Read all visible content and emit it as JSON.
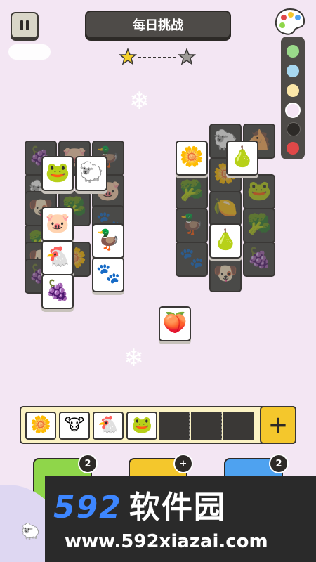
{
  "header": {
    "title": "每日挑战"
  },
  "pause_icon": "pause-icon",
  "progress": {
    "start_icon": "star-filled-icon",
    "end_icon": "star-empty-icon"
  },
  "palette": {
    "icon": "palette-icon",
    "colors": [
      "#9ad98a",
      "#a8d8f0",
      "#fbe6a8",
      "#f5e6f5",
      "#2d2a27",
      "#e04848"
    ]
  },
  "board": {
    "left_tiles": [
      {
        "glyph": "🍇",
        "state": "dark"
      },
      {
        "glyph": "🐷",
        "state": "dark"
      },
      {
        "glyph": "🦆",
        "state": "dark"
      },
      {
        "glyph": "🐸",
        "state": "light"
      },
      {
        "glyph": "🐑",
        "state": "light"
      },
      {
        "glyph": "🐑",
        "state": "dark"
      },
      {
        "glyph": "🐷",
        "state": "dark"
      },
      {
        "glyph": "🥦",
        "state": "dark"
      },
      {
        "glyph": "🐶",
        "state": "dark"
      },
      {
        "glyph": "🐷",
        "state": "light"
      },
      {
        "glyph": "🐶",
        "state": "dark"
      },
      {
        "glyph": "🦆",
        "state": "light"
      },
      {
        "glyph": "🐔",
        "state": "light"
      },
      {
        "glyph": "🌼",
        "state": "dark"
      },
      {
        "glyph": "🐾",
        "state": "light"
      },
      {
        "glyph": "🍇",
        "state": "light"
      }
    ],
    "right_tiles": [
      {
        "glyph": "🐑",
        "state": "dark"
      },
      {
        "glyph": "🐴",
        "state": "dark"
      },
      {
        "glyph": "🌼",
        "state": "light"
      },
      {
        "glyph": "🍐",
        "state": "light"
      },
      {
        "glyph": "🥦",
        "state": "dark"
      },
      {
        "glyph": "🐸",
        "state": "dark"
      },
      {
        "glyph": "🍋",
        "state": "dark"
      },
      {
        "glyph": "🌼",
        "state": "dark"
      },
      {
        "glyph": "🦆",
        "state": "dark"
      },
      {
        "glyph": "🍐",
        "state": "light"
      },
      {
        "glyph": "🥦",
        "state": "dark"
      },
      {
        "glyph": "🐾",
        "state": "dark"
      },
      {
        "glyph": "🐶",
        "state": "dark"
      },
      {
        "glyph": "🍇",
        "state": "dark"
      }
    ],
    "single_tile": {
      "glyph": "🍑",
      "state": "light"
    }
  },
  "tray": {
    "slots": [
      {
        "glyph": "🌼",
        "name": "flower"
      },
      {
        "glyph": "🐮",
        "name": "cow"
      },
      {
        "glyph": "🐔",
        "name": "chicken"
      },
      {
        "glyph": "🐸",
        "name": "frog"
      },
      {
        "glyph": "",
        "name": "empty"
      },
      {
        "glyph": "",
        "name": "empty"
      },
      {
        "glyph": "",
        "name": "empty"
      }
    ],
    "add_label": "+"
  },
  "tools": [
    {
      "name": "undo-tool",
      "color": "#8fd64a",
      "badge": "2"
    },
    {
      "name": "hint-tool",
      "color": "#f4c72c",
      "badge": "+"
    },
    {
      "name": "shuffle-tool",
      "color": "#4ea2f0",
      "badge": "2"
    }
  ],
  "watermark": {
    "logo_number": "592",
    "logo_text": "软件园",
    "url": "www.592xiazai.com"
  }
}
